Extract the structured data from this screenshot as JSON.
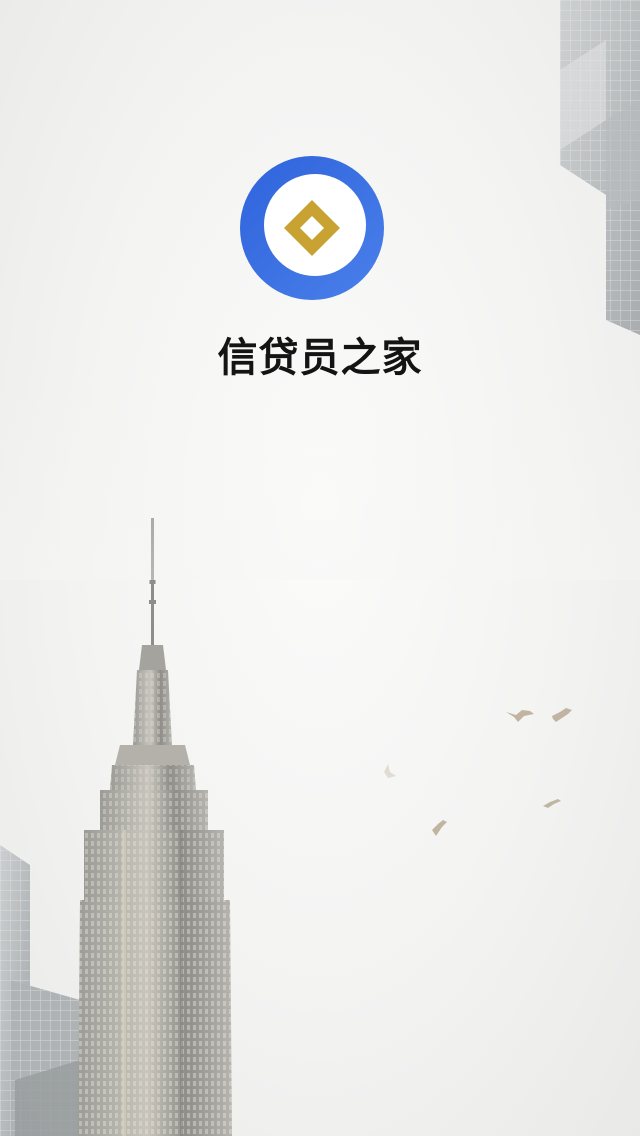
{
  "app": {
    "title": "信贷员之家",
    "logo_icon": "diamond-ring-logo-icon"
  },
  "colors": {
    "logo_ring_blue": "#3a6fe0",
    "logo_diamond_gold": "#c9a234",
    "background": "#f4f4f3"
  }
}
